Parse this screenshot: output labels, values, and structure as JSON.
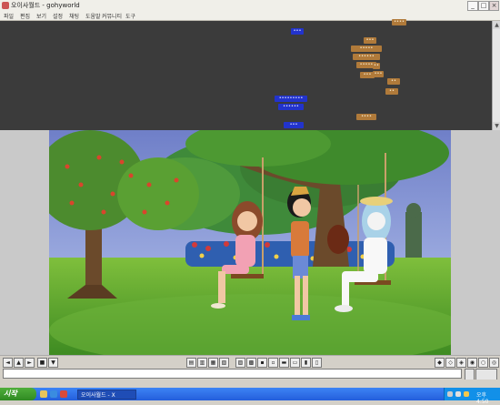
{
  "window": {
    "title": "오이사월드 - gohyworld",
    "min_label": "_",
    "max_label": "□",
    "close_label": "×"
  },
  "menubar": {
    "items": [
      "파일",
      "편집",
      "보기",
      "설정",
      "채팅",
      "도움말",
      "커뮤니티",
      "도구"
    ]
  },
  "chat": {
    "bubbles": [
      {
        "text": "••••",
        "color": "brown"
      },
      {
        "text": "•••",
        "color": "blue"
      },
      {
        "text": "•••",
        "color": "brown"
      },
      {
        "text": "•••••",
        "color": "brown"
      },
      {
        "text": "••••••",
        "color": "brown"
      },
      {
        "text": "•••••",
        "color": "brown"
      },
      {
        "text": "••",
        "color": "brown"
      },
      {
        "text": "•••",
        "color": "brown"
      },
      {
        "text": "•••",
        "color": "brown"
      },
      {
        "text": "••",
        "color": "brown"
      },
      {
        "text": "•••••••••",
        "color": "blue"
      },
      {
        "text": "••••••",
        "color": "blue"
      },
      {
        "text": "••••",
        "color": "brown"
      },
      {
        "text": "•••",
        "color": "blue"
      }
    ]
  },
  "toolbar": {
    "left_buttons": [
      "◄",
      "▲",
      "►",
      "■",
      "▼"
    ],
    "center_buttons": [
      "▤",
      "▥",
      "▦",
      "▧",
      "▨",
      "▩",
      "▪",
      "▫",
      "▬",
      "▭",
      "▮",
      "▯"
    ],
    "right_buttons": [
      "◆",
      "◇",
      "◈",
      "◉",
      "○",
      "◎"
    ]
  },
  "chat_input": {
    "value": ""
  },
  "taskbar": {
    "start_label": "시작",
    "task_label": "오이사월드 - X",
    "clock": "오후 4:50"
  },
  "colors": {
    "chat_bg": "#3b3b3b",
    "bubble_brown": "#b07a3a",
    "bubble_blue": "#2233cc",
    "taskbar_blue": "#245edb",
    "start_green": "#2f8a22"
  }
}
